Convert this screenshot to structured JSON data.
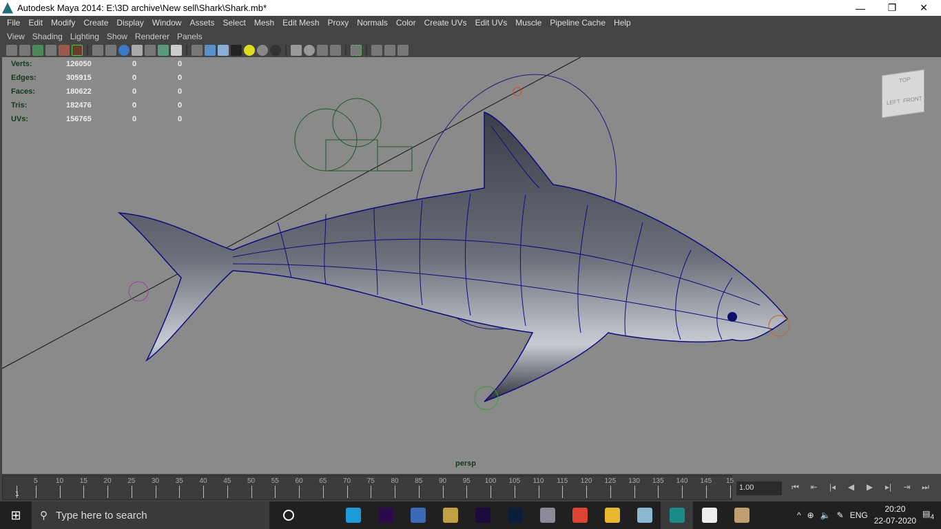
{
  "window": {
    "title": "Autodesk Maya 2014: E:\\3D archive\\New sell\\Shark\\Shark.mb*",
    "minimize": "—",
    "maximize": "❐",
    "close": "✕"
  },
  "menu": [
    "File",
    "Edit",
    "Modify",
    "Create",
    "Display",
    "Window",
    "Assets",
    "Select",
    "Mesh",
    "Edit Mesh",
    "Proxy",
    "Normals",
    "Color",
    "Create UVs",
    "Edit UVs",
    "Muscle",
    "Pipeline Cache",
    "Help"
  ],
  "panel_menu": [
    "View",
    "Shading",
    "Lighting",
    "Show",
    "Renderer",
    "Panels"
  ],
  "hud": [
    {
      "label": "Verts:",
      "value": "126050",
      "a": "0",
      "b": "0"
    },
    {
      "label": "Edges:",
      "value": "305915",
      "a": "0",
      "b": "0"
    },
    {
      "label": "Faces:",
      "value": "180622",
      "a": "0",
      "b": "0"
    },
    {
      "label": "Tris:",
      "value": "182476",
      "a": "0",
      "b": "0"
    },
    {
      "label": "UVs:",
      "value": "156765",
      "a": "0",
      "b": "0"
    }
  ],
  "viewcube": {
    "top": "TOP",
    "left": "LEFT",
    "front": "FRONT"
  },
  "camera_label": "persp",
  "timeline": {
    "current_frame": "1",
    "ticks": [
      "5",
      "10",
      "15",
      "20",
      "25",
      "30",
      "35",
      "40",
      "45",
      "50",
      "55",
      "60",
      "65",
      "70",
      "75",
      "80",
      "85",
      "90",
      "95",
      "100",
      "105",
      "110",
      "115",
      "120",
      "125",
      "130",
      "135",
      "140",
      "145",
      "15"
    ]
  },
  "frame_field": "1.00",
  "playback": [
    "⏮",
    "⇤",
    "|◂",
    "◀",
    "▶",
    "▸|",
    "⇥",
    "⏭"
  ],
  "taskbar": {
    "search_placeholder": "Type here to search",
    "lang": "ENG",
    "time": "20:20",
    "date": "22-07-2020",
    "notifications": "4",
    "apps": [
      {
        "name": "cortana",
        "color": "#202020"
      },
      {
        "name": "task-view",
        "color": "#202020"
      },
      {
        "name": "edge",
        "color": "#1d9bd6"
      },
      {
        "name": "premiere",
        "color": "#2a0a4a"
      },
      {
        "name": "app-eagle",
        "color": "#3a6ab8"
      },
      {
        "name": "media-app",
        "color": "#c0a040"
      },
      {
        "name": "after-effects",
        "color": "#1c0a3c"
      },
      {
        "name": "photoshop",
        "color": "#0a1e3c"
      },
      {
        "name": "app-x",
        "color": "#8a8a9a"
      },
      {
        "name": "chrome",
        "color": "#dd4433"
      },
      {
        "name": "file-explorer",
        "color": "#e8b830"
      },
      {
        "name": "app-glass",
        "color": "#8ab8d0"
      },
      {
        "name": "maya",
        "color": "#1a8a8a"
      },
      {
        "name": "photos",
        "color": "#eeeeee"
      },
      {
        "name": "paint",
        "color": "#c0a070"
      }
    ]
  }
}
